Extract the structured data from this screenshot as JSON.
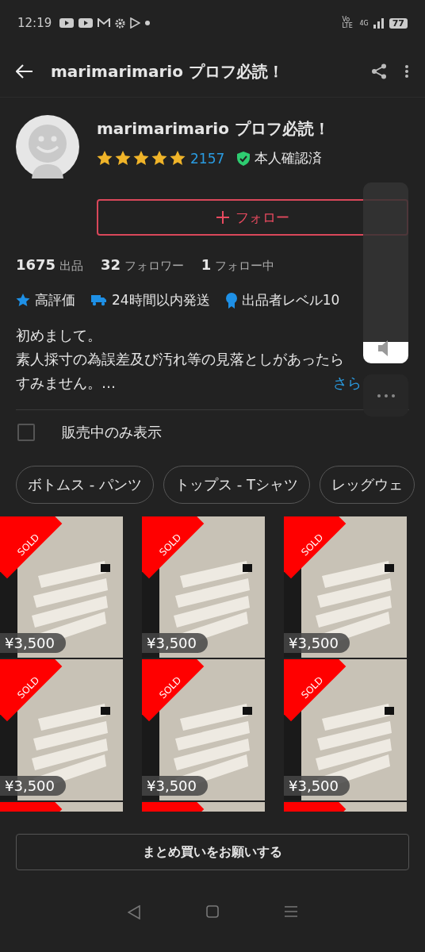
{
  "status_bar": {
    "time": "12:19",
    "network_label": "Vo LTE",
    "signal_label": "4G",
    "battery": "77"
  },
  "header": {
    "title": "marimarimario プロフ必読！"
  },
  "profile": {
    "name": "marimarimario プロフ必読！",
    "stars": 5,
    "review_count": "2157",
    "verified_label": "本人確認済"
  },
  "follow_button": {
    "label": "フォロー"
  },
  "stats": [
    "**1675** 出品",
    "**32** フォロワー",
    "**1** フォロー中"
  ],
  "badges": [
    {
      "kind": "star",
      "label": "高評価"
    },
    {
      "kind": "truck",
      "label": "24時間以内発送"
    },
    {
      "kind": "medal",
      "label": "出品者レベル10"
    }
  ],
  "description": {
    "lines": [
      "初めまして。",
      "素人採寸の為誤差及び汚れ等の見落としがあったら",
      "すみません。…"
    ],
    "more_link": "さら"
  },
  "filter": {
    "label": "販売中のみ表示",
    "checked": false
  },
  "category_chips": [
    "ボトムス - パンツ",
    "トップス - Tシャツ",
    "レッグウェ"
  ],
  "products": [
    {
      "ribbon": "SOLD",
      "price": "¥3,500"
    },
    {
      "ribbon": "SOLD",
      "price": "¥3,500"
    },
    {
      "ribbon": "SOLD",
      "price": "¥3,500"
    },
    {
      "ribbon": "SOLD",
      "price": "¥3,500"
    },
    {
      "ribbon": "SOLD",
      "price": "¥3,500"
    },
    {
      "ribbon": "SOLD",
      "price": "¥3,500"
    }
  ],
  "partial_row": [
    {
      "sold": true
    },
    {
      "sold": true
    },
    {
      "sold": true
    }
  ],
  "bulk_button": {
    "label": "まとめ買いをお願いする"
  },
  "volume_panel": {
    "level": 0.12
  }
}
